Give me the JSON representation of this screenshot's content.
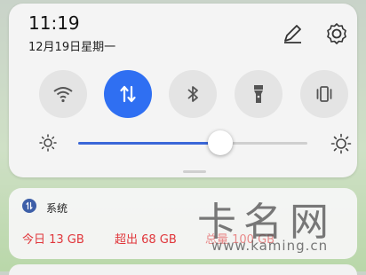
{
  "status": {
    "time": "11:19",
    "date": "12月19日星期一"
  },
  "toolbar": {
    "edit_icon": "pencil-icon",
    "settings_icon": "gear-icon"
  },
  "quick_toggles": [
    {
      "icon": "wifi-icon",
      "active": false
    },
    {
      "icon": "mobile-data-icon",
      "active": true
    },
    {
      "icon": "bluetooth-icon",
      "active": false
    },
    {
      "icon": "flashlight-icon",
      "active": false
    },
    {
      "icon": "vibrate-icon",
      "active": false
    }
  ],
  "brightness": {
    "level": 0.62,
    "icon_low": "sun-low-icon",
    "icon_high": "sun-high-icon"
  },
  "notification": {
    "app_name": "系统",
    "stats": [
      "今日 13 GB",
      "超出 68 GB",
      "总量 100 GB"
    ]
  },
  "watermark": {
    "logo": "卡名网",
    "url": "www.kaming.cn"
  },
  "colors": {
    "accent": "#2f6ff2",
    "alert": "#e0363b"
  }
}
